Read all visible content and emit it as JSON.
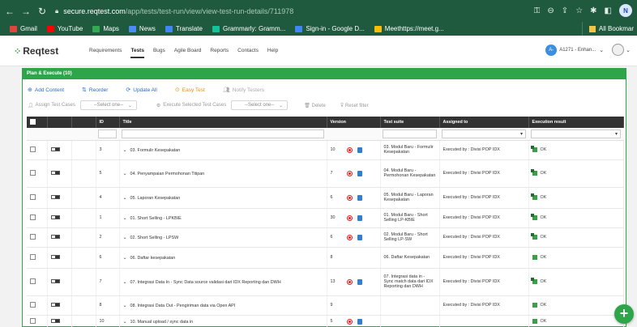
{
  "browser": {
    "url_host": "secure.reqtest.com",
    "url_path": "/app/tests/test-run/view/view-test-run-details/711978",
    "profile_initial": "N",
    "bookmarks": [
      {
        "label": "Gmail",
        "color": "#e0443e"
      },
      {
        "label": "YouTube",
        "color": "#ff0000"
      },
      {
        "label": "Maps",
        "color": "#34a853"
      },
      {
        "label": "News",
        "color": "#4c8bf5"
      },
      {
        "label": "Translate",
        "color": "#4285f4"
      },
      {
        "label": "Grammarly: Gramm...",
        "color": "#15c39a"
      },
      {
        "label": "Sign-in - Google D...",
        "color": "#4285f4"
      },
      {
        "label": "Meethttps://meet.g...",
        "color": "#fbbc04"
      }
    ],
    "all_bookmarks": "All Bookmar"
  },
  "app": {
    "logo": "Reqtest",
    "nav": [
      "Requirements",
      "Tests",
      "Bugs",
      "Agile Board",
      "Reports",
      "Contacts",
      "Help"
    ],
    "active_nav": "Tests",
    "user_initials": "A-",
    "user_label": "A1271 - Enhan..."
  },
  "panel": {
    "title": "Plan & Execute (10)",
    "toolbar": {
      "add_content": "Add Content",
      "reorder": "Reorder",
      "update_all": "Update All",
      "easy_test": "Easy Test",
      "notify_testers": "Notify Testers"
    },
    "toolbar2": {
      "assign_test_cases": "Assign Test Cases",
      "select_placeholder_1": "--Select one--",
      "execute_selected": "Execute Selected Test Cases",
      "select_placeholder_2": "--Select one--",
      "delete": "Delete",
      "reset_filter": "Reset filter"
    },
    "columns": [
      "ID",
      "Title",
      "Version",
      "Test suite",
      "Assigned to",
      "Execution result"
    ],
    "rows": [
      {
        "id": "3",
        "title": "03. Formulir Kesepakatan",
        "version": "10",
        "icons": true,
        "suite": "03. Modul Baru - Formulir Kesepakatan",
        "assigned": "Executed by : Divisi POP IDX",
        "result": "OK",
        "dual": true
      },
      {
        "id": "5",
        "title": "04. Penyampaian Permohonan Titipan",
        "version": "7",
        "icons": true,
        "suite": "04. Modul Baru - Permohonan Kesepakatan",
        "assigned": "Executed by : Divisi POP IDX",
        "result": "OK",
        "dual": true
      },
      {
        "id": "4",
        "title": "05. Laporan Kesepakatan",
        "version": "6",
        "icons": true,
        "suite": "05. Modul Baru - Laporan Kesepakatan",
        "assigned": "Executed by : Divisi POP IDX",
        "result": "OK",
        "dual": true
      },
      {
        "id": "1",
        "title": "01. Short Selling - LPKBIE",
        "version": "30",
        "icons": true,
        "suite": "01. Modul Baru - Short Selling LP-KBIE",
        "assigned": "Executed by : Divisi POP IDX",
        "result": "OK",
        "dual": true
      },
      {
        "id": "2",
        "title": "02. Short Selling - LPSW",
        "version": "6",
        "icons": true,
        "suite": "02. Modul Baru - Short Selling LP-SW",
        "assigned": "Executed by : Divisi POP IDX",
        "result": "OK",
        "dual": true
      },
      {
        "id": "6",
        "title": "06. Daftar kesepakatan",
        "version": "8",
        "icons": false,
        "suite": "06. Daftar Kesepakatan",
        "assigned": "Executed by : Divisi POP IDX",
        "result": "OK",
        "dual": false
      },
      {
        "id": "7",
        "title": "07. Integrasi Data In - Sync Data source validasi dari IDX Reporting dan DWH",
        "version": "13",
        "icons": true,
        "suite": "07. Integrasi data in - Sync match data dari IDX Reporting dan DWH",
        "assigned": "Executed by : Divisi POP IDX",
        "result": "OK",
        "dual": true
      },
      {
        "id": "8",
        "title": "08. Integrasi Data Out - Pengiriman data via Open API",
        "version": "9",
        "icons": false,
        "suite": "",
        "assigned": "Executed by : Divisi POP IDX",
        "result": "OK",
        "dual": false
      },
      {
        "id": "10",
        "title": "10. Manual upload / sync data in",
        "version": "5",
        "icons": true,
        "suite": "",
        "assigned": "",
        "result": "OK",
        "dual": false
      }
    ]
  },
  "colors": {
    "brand": "#2ea54b",
    "browser": "#1f5a3f",
    "link": "#2a6ec2",
    "orange": "#ea8e1b"
  }
}
